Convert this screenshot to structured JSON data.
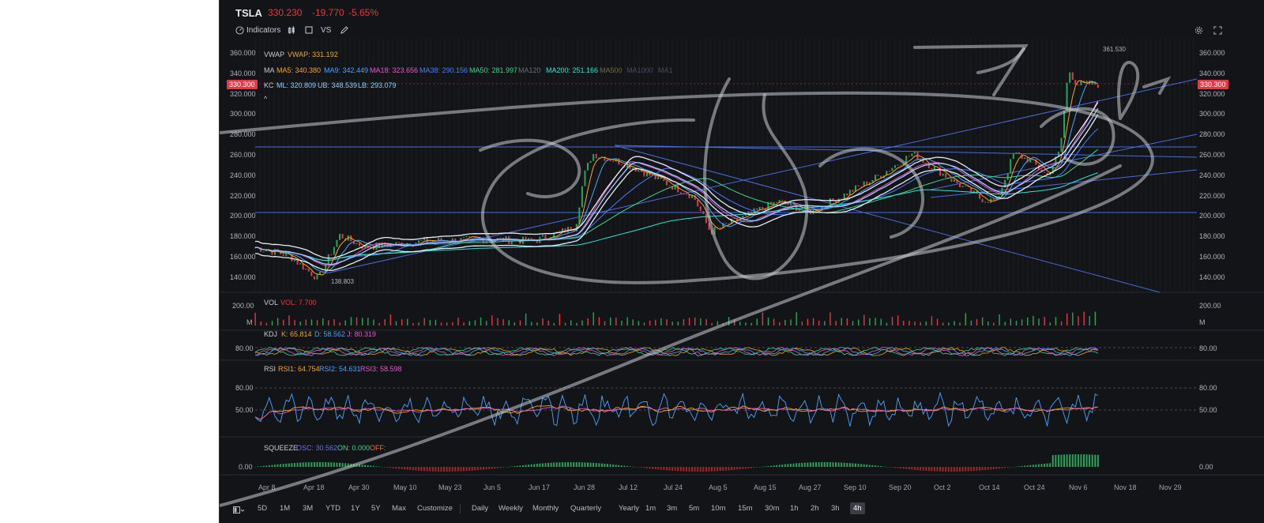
{
  "header": {
    "symbol": "TSLA",
    "price": "330.230",
    "change": "-19.770",
    "change_pct": "-5.65%",
    "toolbar": {
      "indicators_label": "Indicators",
      "compare_label": "VS"
    },
    "icons": [
      "gauge-icon",
      "candles-icon",
      "square-icon",
      "pencil-icon",
      "settings-icon",
      "fullscreen-icon"
    ]
  },
  "indicators": {
    "vwap": {
      "name": "VWAP",
      "value": "VWAP: 331.192"
    },
    "ma": {
      "name": "MA",
      "ma5": "MA5: 340.380",
      "ma9": "MA9: 342.449",
      "ma18": "MA18: 323.656",
      "ma38": "MA38: 290.156",
      "ma50": "MA50: 281.997",
      "ma120": "MA120",
      "ma200": "MA200: 251.166",
      "ma500": "MA500",
      "ma1000": "MA1000",
      "ma1": "MA1"
    },
    "kc": {
      "name": "KC",
      "ml": "ML: 320.809",
      "ub": "UB: 348.539",
      "lb": "LB: 293.079"
    },
    "collapse": "^"
  },
  "price_axis": [
    "360.000",
    "340.000",
    "320.000",
    "300.000",
    "280.000",
    "260.000",
    "240.000",
    "220.000",
    "200.000",
    "180.000",
    "160.000",
    "140.000"
  ],
  "current_price_tag": "330.300",
  "high_label": "361.530",
  "low_label": "138.803",
  "vol": {
    "name": "VOL",
    "value": "VOL: 7.700",
    "axis_top": "200.00",
    "axis_unit": "M"
  },
  "kdj": {
    "name": "KDJ",
    "k": "K: 65.814",
    "d": "D: 58.562",
    "j": "J: 80.319",
    "axis": "80.00"
  },
  "rsi": {
    "name": "RSI",
    "rsi1": "RSI1: 64.754",
    "rsi2": "RSI2: 54.631",
    "rsi3": "RSI3: 58.598",
    "axis_top": "80.00",
    "axis_mid": "50.00"
  },
  "squeeze": {
    "name": "SQUEEZE",
    "osc": "OSC: 30.562",
    "on": "ON: 0.000",
    "off": "OFF:",
    "axis": "0.00"
  },
  "x_axis": [
    "Apr 8",
    "Apr 18",
    "Apr 30",
    "May 10",
    "May 23",
    "Jun 5",
    "Jun 17",
    "Jun 28",
    "Jul 12",
    "Jul 24",
    "Aug 5",
    "Aug 15",
    "Aug 27",
    "Sep 10",
    "Sep 20",
    "Oct 2",
    "Oct 14",
    "Oct 24",
    "Nov 6",
    "Nov 18",
    "Nov 29"
  ],
  "ranges": [
    "5D",
    "1M",
    "3M",
    "YTD",
    "1Y",
    "5Y",
    "Max",
    "Customize"
  ],
  "intervals": [
    "Daily",
    "Weekly",
    "Monthly",
    "Quarterly",
    "Yearly",
    "1m",
    "3m",
    "5m",
    "10m",
    "15m",
    "30m",
    "1h",
    "2h",
    "3h",
    "4h"
  ],
  "active_interval": "4h",
  "colors": {
    "up": "#26a65b",
    "down": "#e23b45",
    "accent": "#e23b45",
    "background": "#131417",
    "trendline": "#4a6bd8"
  }
}
